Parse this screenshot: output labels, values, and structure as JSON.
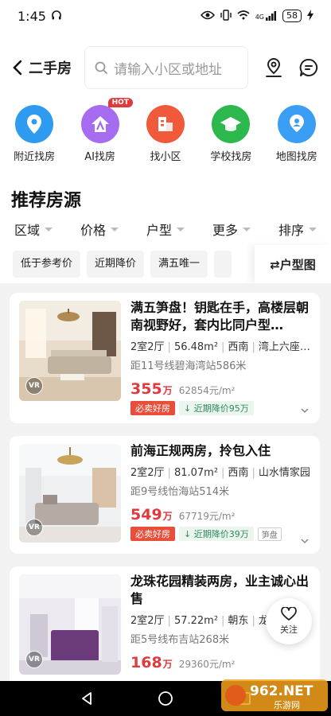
{
  "status": {
    "time": "1:45",
    "battery": "58",
    "network": "4G"
  },
  "header": {
    "back_label": "二手房",
    "search_placeholder": "请输入小区或地址"
  },
  "quick": [
    {
      "label": "附近找房",
      "icon": "location-pin-icon",
      "color": "#2e9bf0"
    },
    {
      "label": "AI找房",
      "icon": "ai-house-icon",
      "color": "#a66cf0",
      "badge": "HOT"
    },
    {
      "label": "找小区",
      "icon": "building-icon",
      "color": "#f05a3a"
    },
    {
      "label": "学校找房",
      "icon": "graduation-cap-icon",
      "color": "#2db84d"
    },
    {
      "label": "地图找房",
      "icon": "map-person-icon",
      "color": "#3a9ef5"
    }
  ],
  "section_title": "推荐房源",
  "filters": [
    "区域",
    "价格",
    "户型",
    "更多",
    "排序"
  ],
  "chips": [
    "低于参考价",
    "近期降价",
    "满五唯一"
  ],
  "layout_chip": "⇄户型图",
  "listings": [
    {
      "title": "满五笋盘！钥匙在手，高楼层朝南视野好，套内比同户型…",
      "layout": "2室2厅",
      "area": "56.48m²",
      "orientation": "西南",
      "community": "湾上六座…",
      "subway": "距11号线碧海湾站586米",
      "price": "355",
      "price_unit": "万",
      "unit_price": "62854元/m²",
      "tags": [
        "必卖好房",
        "近期降价95万"
      ]
    },
    {
      "title": "前海正规两房，拎包入住",
      "layout": "2室2厅",
      "area": "81.07m²",
      "orientation": "西南",
      "community": "山水情家园",
      "subway": "距9号线怡海站514米",
      "price": "549",
      "price_unit": "万",
      "unit_price": "67719元/m²",
      "tags": [
        "必卖好房",
        "近期降价39万",
        "笋盘"
      ]
    },
    {
      "title": "龙珠花园精装两房，业主诚心出售",
      "layout": "2室2厅",
      "area": "57.22m²",
      "orientation": "朝东",
      "community": "龙珠…",
      "subway": "距5号线布吉站268米",
      "price": "168",
      "price_unit": "万",
      "unit_price": "29360元/m²",
      "tags": []
    }
  ],
  "vr_label": "VR",
  "fav_label": "关注",
  "watermark": {
    "brand": "962.NET",
    "sub": "乐游网"
  }
}
